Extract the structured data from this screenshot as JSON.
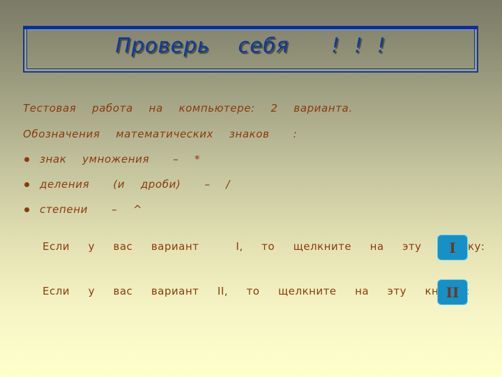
{
  "slide": {
    "title": "Проверь  себя   ! ! !",
    "intro_lines": [
      "Тестовая  работа  на  компьютере:  2  варианта.",
      "Обозначения  математических  знаков   :"
    ],
    "bullets": [
      {
        "label": "знак  умножения   –  *",
        "icon": "bullet-icon"
      },
      {
        "label": "деления   (и  дроби)   –  /",
        "icon": "bullet-icon"
      },
      {
        "label": "степени   –  ^",
        "icon": "bullet-icon"
      }
    ],
    "variants": [
      {
        "prompt": "Если  у  вас  вариант    I,  то  щелкните  на  эту  кнопку:",
        "button_label": "I"
      },
      {
        "prompt": "Если  у  вас  вариант  II,  то  щелкните  на  эту  кнопку:",
        "button_label": "II"
      }
    ]
  },
  "colors": {
    "title": "#0d3a9a",
    "frame": "#0a2f9a",
    "body_text": "#8b3a0c",
    "button_bg": "#1591c8",
    "button_text": "#7a3414",
    "background_top": "#7a7a66",
    "background_bottom": "#ffffcc"
  }
}
